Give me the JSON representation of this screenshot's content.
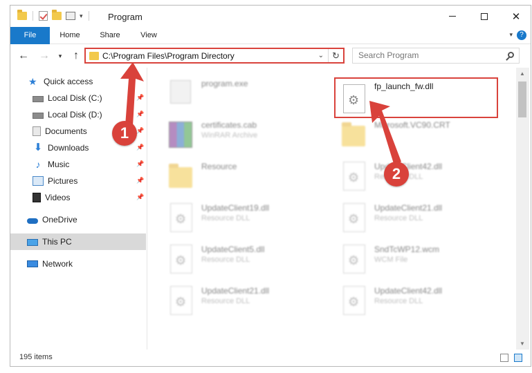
{
  "window": {
    "title": "Program",
    "minimize": "—",
    "maximize": "☐",
    "close": "✕"
  },
  "ribbon": {
    "tabs": [
      "File",
      "Home",
      "Share",
      "View"
    ],
    "help": "?"
  },
  "address_bar": {
    "path": "C:\\Program Files\\Program Directory",
    "search_placeholder": "Search Program"
  },
  "nav_pane": {
    "items": [
      {
        "label": "Quick access",
        "icon": "star-icon",
        "pinned": false
      },
      {
        "label": "Local Disk (C:)",
        "icon": "drive-icon",
        "pinned": true
      },
      {
        "label": "Local Disk (D:)",
        "icon": "drive-icon",
        "pinned": true
      },
      {
        "label": "Documents",
        "icon": "documents-icon",
        "pinned": true
      },
      {
        "label": "Downloads",
        "icon": "download-icon",
        "pinned": true
      },
      {
        "label": "Music",
        "icon": "music-icon",
        "pinned": true
      },
      {
        "label": "Pictures",
        "icon": "pictures-icon",
        "pinned": true
      },
      {
        "label": "Videos",
        "icon": "videos-icon",
        "pinned": true
      },
      {
        "label": "OneDrive",
        "icon": "cloud-icon",
        "pinned": false
      },
      {
        "label": "This PC",
        "icon": "computer-icon",
        "pinned": false,
        "selected": true
      },
      {
        "label": "Network",
        "icon": "network-icon",
        "pinned": false
      }
    ]
  },
  "files": [
    {
      "name": "program.exe",
      "type": "",
      "icon": "exe-icon"
    },
    {
      "name": "fp_launch_fw.dll",
      "type": "",
      "icon": "dll-icon",
      "highlighted": true
    },
    {
      "name": "certificates.cab",
      "type": "WinRAR Archive",
      "icon": "archive-icon"
    },
    {
      "name": "Microsoft.VC90.CRT",
      "type": "",
      "icon": "folder-icon"
    },
    {
      "name": "Resource",
      "type": "",
      "icon": "folder-icon"
    },
    {
      "name": "UpdateClient42.dll",
      "type": "Resource DLL",
      "icon": "dll-icon"
    },
    {
      "name": "UpdateClient19.dll",
      "type": "Resource DLL",
      "icon": "dll-icon"
    },
    {
      "name": "UpdateClient21.dll",
      "type": "Resource DLL",
      "icon": "dll-icon"
    },
    {
      "name": "UpdateClient5.dll",
      "type": "Resource DLL",
      "icon": "dll-icon"
    },
    {
      "name": "SndTcWP12.wcm",
      "type": "WCM File",
      "icon": "file-icon"
    },
    {
      "name": "UpdateClient21.dll",
      "type": "Resource DLL",
      "icon": "dll-icon"
    },
    {
      "name": "UpdateClient42.dll",
      "type": "Resource DLL",
      "icon": "dll-icon"
    }
  ],
  "status": {
    "item_count": "195 items"
  },
  "callouts": {
    "one": "1",
    "two": "2"
  },
  "colors": {
    "accent": "#1979ca",
    "annotation_red": "#d9423b"
  }
}
